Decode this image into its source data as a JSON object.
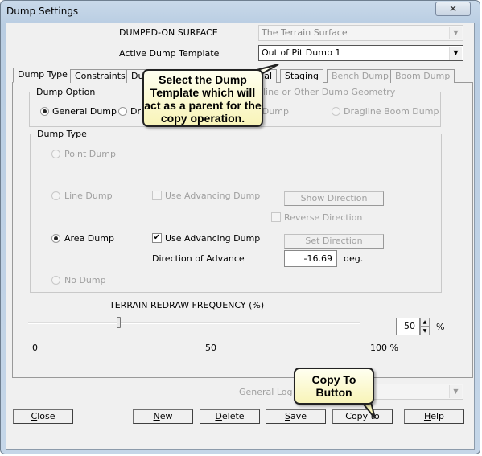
{
  "window": {
    "title": "Dump Settings",
    "close_icon": "close-icon"
  },
  "header": {
    "surface_label": "DUMPED-ON SURFACE",
    "surface_value": "The Terrain Surface",
    "template_label": "Active Dump Template",
    "template_value": "Out of Pit Dump 1"
  },
  "tabs": [
    {
      "label": "Dump Type",
      "active": true
    },
    {
      "label": "Constraints"
    },
    {
      "label": "Du"
    },
    {
      "label": "ial"
    },
    {
      "label": "Staging"
    },
    {
      "label": "Bench Dump",
      "disabled": true
    },
    {
      "label": "Boom Dump",
      "disabled": true
    }
  ],
  "dump_option": {
    "label": "Dump Option",
    "general": "General Dump",
    "dragline_partial": "Dr",
    "geometry_label": "gline or Other Dump Geometry",
    "bench": "Bench Dump",
    "boom": "Dragline Boom Dump",
    "selected": "General Dump"
  },
  "dump_type": {
    "label": "Dump Type",
    "point": "Point Dump",
    "line": "Line Dump",
    "area": "Area Dump",
    "none": "No Dump",
    "selected": "Area Dump",
    "line_adv": "Use Advancing Dump",
    "show_direction": "Show Direction",
    "reverse_direction": "Reverse Direction",
    "area_adv": "Use Advancing Dump",
    "area_adv_checked": true,
    "set_direction": "Set Direction",
    "direction_label": "Direction of Advance",
    "direction_value": "-16.69",
    "direction_unit": "deg."
  },
  "redraw": {
    "label": "TERRAIN  REDRAW  FREQUENCY (%)",
    "value": 50,
    "value_text": "50",
    "unit": "%",
    "tick_min": "0",
    "tick_mid": "50",
    "tick_max": "100 %"
  },
  "log": {
    "label": "General Log"
  },
  "buttons": {
    "close": "lose",
    "close_u": "C",
    "new": "ew",
    "new_u": "N",
    "delete": "elete",
    "delete_u": "D",
    "save": "ave",
    "save_u": "S",
    "copy": "Copy to",
    "help": "elp",
    "help_u": "H"
  },
  "callouts": {
    "template": "Select the Dump Template which will act as a parent for the copy operation.",
    "copy": "Copy To Button"
  }
}
